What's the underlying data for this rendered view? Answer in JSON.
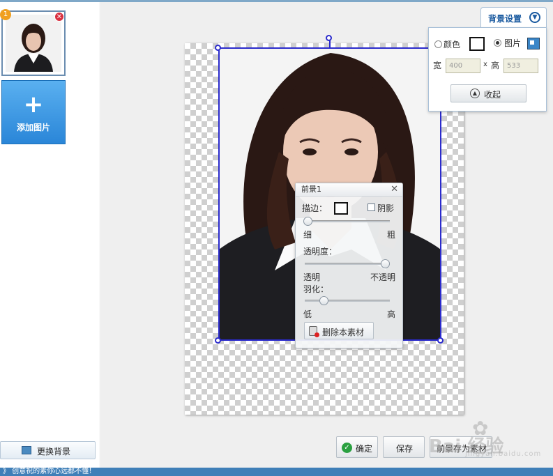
{
  "thumbnails": [
    {
      "badge": "1"
    }
  ],
  "left_panel": {
    "add_label": "添加图片",
    "change_bg_label": "更换背景"
  },
  "foreground_panel": {
    "title": "前景1",
    "stroke_label": "描边：",
    "shadow_label": "阴影",
    "stroke_width": {
      "min_label": "细",
      "max_label": "粗",
      "value": 0.0
    },
    "opacity_label": "透明度：",
    "opacity": {
      "min_label": "透明",
      "max_label": "不透明",
      "value": 0.95
    },
    "feather_label": "羽化：",
    "feather": {
      "min_label": "低",
      "max_label": "高",
      "value": 0.2
    },
    "delete_label": "删除本素材"
  },
  "background_settings": {
    "tab_label": "背景设置",
    "color_label": "颜色",
    "image_label": "图片",
    "mode": "image",
    "width_label": "宽",
    "height_label": "高",
    "times_label": "x",
    "width_value": "400",
    "height_value": "533",
    "collapse_label": "收起"
  },
  "actions": {
    "ok_label": "确定",
    "save_label": "保存",
    "save_fg_label": "前景存为素材"
  },
  "watermark": {
    "text": "Bai 经验",
    "sub": "jingyan.baidu.com"
  },
  "status": {
    "text": "》 创意祝的素你心远都不懂！"
  },
  "colors": {
    "accent": "#2b2bcc",
    "brand_blue": "#2a86d8",
    "ok_green": "#2aa040"
  }
}
